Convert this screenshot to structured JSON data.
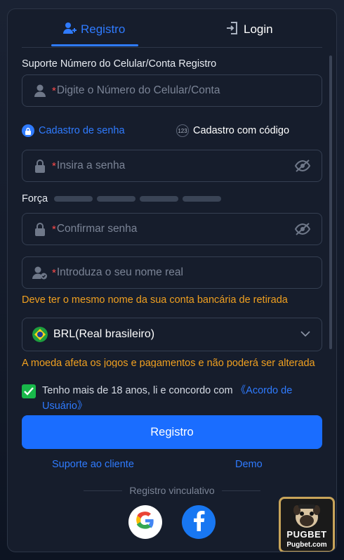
{
  "tabs": {
    "register_label": "Registro",
    "login_label": "Login"
  },
  "form": {
    "account_section_label": "Suporte Número do Celular/Conta Registro",
    "phone_placeholder": "Digite o Número do Celular/Conta",
    "mode_password_label": "Cadastro de senha",
    "mode_code_label": "Cadastro com código",
    "mode_code_badge": "123",
    "password_placeholder": "Insira a senha",
    "strength_label": "Força",
    "strength_level": 0,
    "confirm_placeholder": "Confirmar senha",
    "name_placeholder": "Introduza o seu nome real",
    "name_warning": "Deve ter o mesmo nome da sua conta bancária de retirada",
    "currency_value": "BRL(Real brasileiro)",
    "currency_warning": "A moeda afeta os jogos e pagamentos e não poderá ser alterada",
    "required_mark": "*"
  },
  "agreement": {
    "checked": true,
    "text": "Tenho mais de 18 anos, li e concordo com ",
    "link_label": "《Acordo de Usuário》"
  },
  "submit_label": "Registro",
  "support_link": "Suporte ao cliente",
  "demo_link": "Demo",
  "binding_label": "Registro vinculativo",
  "promo": {
    "brand": "PUGBET",
    "site": "Pugbet.com"
  },
  "colors": {
    "accent": "#2f7bff",
    "warning": "#f0a020",
    "required": "#ff4a4a",
    "check": "#18b84a"
  }
}
